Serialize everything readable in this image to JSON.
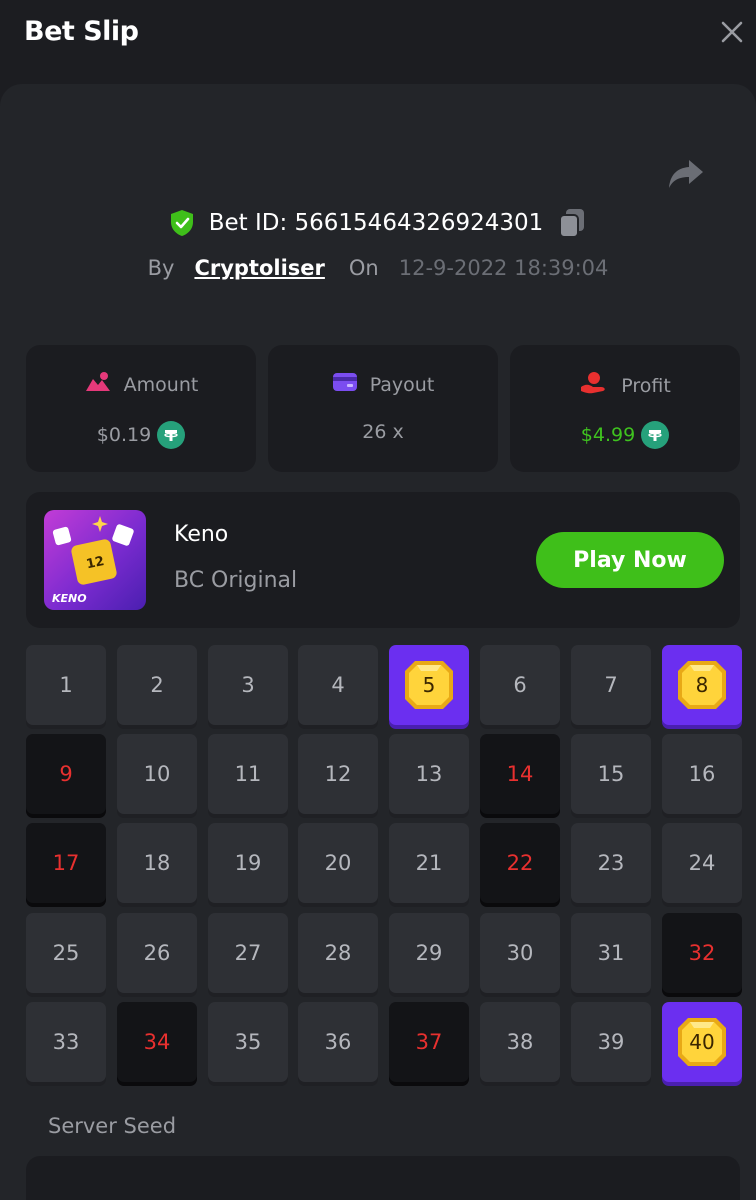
{
  "header": {
    "title": "Bet Slip"
  },
  "bet": {
    "id_text": "Bet ID: 56615464326924301",
    "by_label": "By",
    "user": "Cryptoliser",
    "on_label": "On",
    "date": "12-9-2022 18:39:04"
  },
  "stats": [
    {
      "label": "Amount",
      "value": "$0.19",
      "icon": "amount-icon",
      "coin": true
    },
    {
      "label": "Payout",
      "value": "26 x",
      "icon": "payout-card-icon",
      "coin": false
    },
    {
      "label": "Profit",
      "value": "$4.99",
      "icon": "profit-hand-icon",
      "coin": true
    }
  ],
  "game": {
    "name": "Keno",
    "subtitle": "BC Original",
    "play_label": "Play Now",
    "thumb_text": "KENO",
    "thumb_number": "12"
  },
  "keno": {
    "numbers": [
      1,
      2,
      3,
      4,
      5,
      6,
      7,
      8,
      9,
      10,
      11,
      12,
      13,
      14,
      15,
      16,
      17,
      18,
      19,
      20,
      21,
      22,
      23,
      24,
      25,
      26,
      27,
      28,
      29,
      30,
      31,
      32,
      33,
      34,
      35,
      36,
      37,
      38,
      39,
      40
    ],
    "hits": [
      5,
      8,
      40
    ],
    "misses": [
      9,
      14,
      17,
      22,
      32,
      34,
      37
    ]
  },
  "seed": {
    "label": "Server Seed"
  },
  "colors": {
    "accent_green": "#3fbf1a",
    "hit_purple": "#6b2ff0",
    "miss_red": "#e8302f",
    "tether": "#26a17b"
  }
}
